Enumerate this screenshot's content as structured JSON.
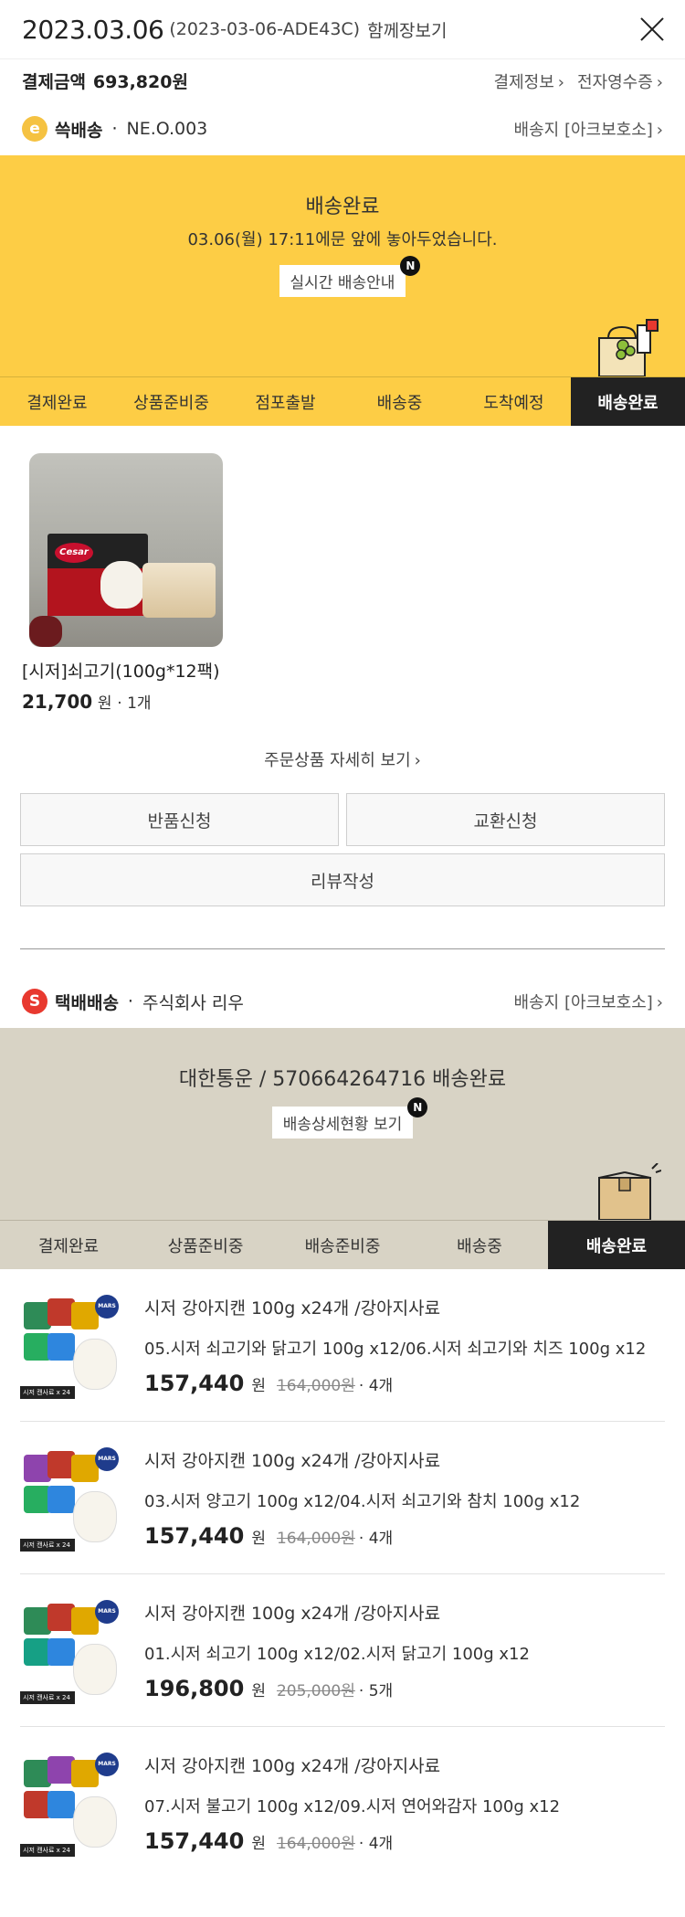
{
  "header": {
    "date": "2023.03.06",
    "order_id": "(2023-03-06-ADE43C)",
    "share_label": "함께장보기"
  },
  "payment": {
    "label": "결제금액",
    "amount": "693,820원",
    "link_info": "결제정보",
    "link_receipt": "전자영수증"
  },
  "shipment1": {
    "badge": "e",
    "name": "쓱배송",
    "dot": "·",
    "carrier": "NE.O.003",
    "destination": "배송지 [아크보호소]",
    "status_title": "배송완료",
    "status_msg": "03.06(월) 17:11에문 앞에 놓아두었습니다.",
    "status_button": "실시간 배송안내",
    "new_badge": "N",
    "steps": [
      "결제완료",
      "상품준비중",
      "점포출발",
      "배송중",
      "도착예정",
      "배송완료"
    ],
    "active_step": 5,
    "product": {
      "logo_text": "Cesar",
      "name": "[시저]쇠고기(100g*12팩)",
      "price": "21,700",
      "unit": "원",
      "qty": "· 1개"
    },
    "more_link": "주문상품 자세히 보기",
    "buttons": {
      "return": "반품신청",
      "exchange": "교환신청",
      "review": "리뷰작성"
    }
  },
  "shipment2": {
    "badge": "S",
    "name": "택배배송",
    "dot": "·",
    "carrier": "주식회사 리우",
    "destination": "배송지 [아크보호소]",
    "status_title": "대한통운 / 570664264716 배송완료",
    "status_button": "배송상세현황 보기",
    "new_badge": "N",
    "steps": [
      "결제완료",
      "상품준비중",
      "배송준비중",
      "배송중",
      "배송완료"
    ],
    "active_step": 4,
    "thumb_strip": "시저 캔사료 x 24",
    "thumb_mars": "MARS",
    "products": [
      {
        "title": "시저 강아지캔 100g x24개 /강아지사료",
        "option": "05.시저 쇠고기와 닭고기 100g x12/06.시저 쇠고기와 치즈 100g x12",
        "price": "157,440",
        "won": "원",
        "orig": "164,000원",
        "count": "· 4개"
      },
      {
        "title": "시저 강아지캔 100g x24개 /강아지사료",
        "option": "03.시저 양고기 100g x12/04.시저 쇠고기와 참치 100g x12",
        "price": "157,440",
        "won": "원",
        "orig": "164,000원",
        "count": "· 4개"
      },
      {
        "title": "시저 강아지캔 100g x24개 /강아지사료",
        "option": "01.시저 쇠고기 100g x12/02.시저 닭고기 100g x12",
        "price": "196,800",
        "won": "원",
        "orig": "205,000원",
        "count": "· 5개"
      },
      {
        "title": "시저 강아지캔 100g x24개 /강아지사료",
        "option": "07.시저 불고기 100g x12/09.시저 연어와감자 100g x12",
        "price": "157,440",
        "won": "원",
        "orig": "164,000원",
        "count": "· 4개"
      }
    ]
  },
  "icons": {
    "close": "close-icon",
    "chevron": "chevron-right-icon",
    "grocery_bag": "grocery-bag-icon",
    "parcel_box": "parcel-box-icon"
  },
  "colors": {
    "yellow": "#fdcd45",
    "beige": "#d8d3c5",
    "active_step": "#222222",
    "badge_e": "#f5c242",
    "badge_s": "#e8392f"
  }
}
